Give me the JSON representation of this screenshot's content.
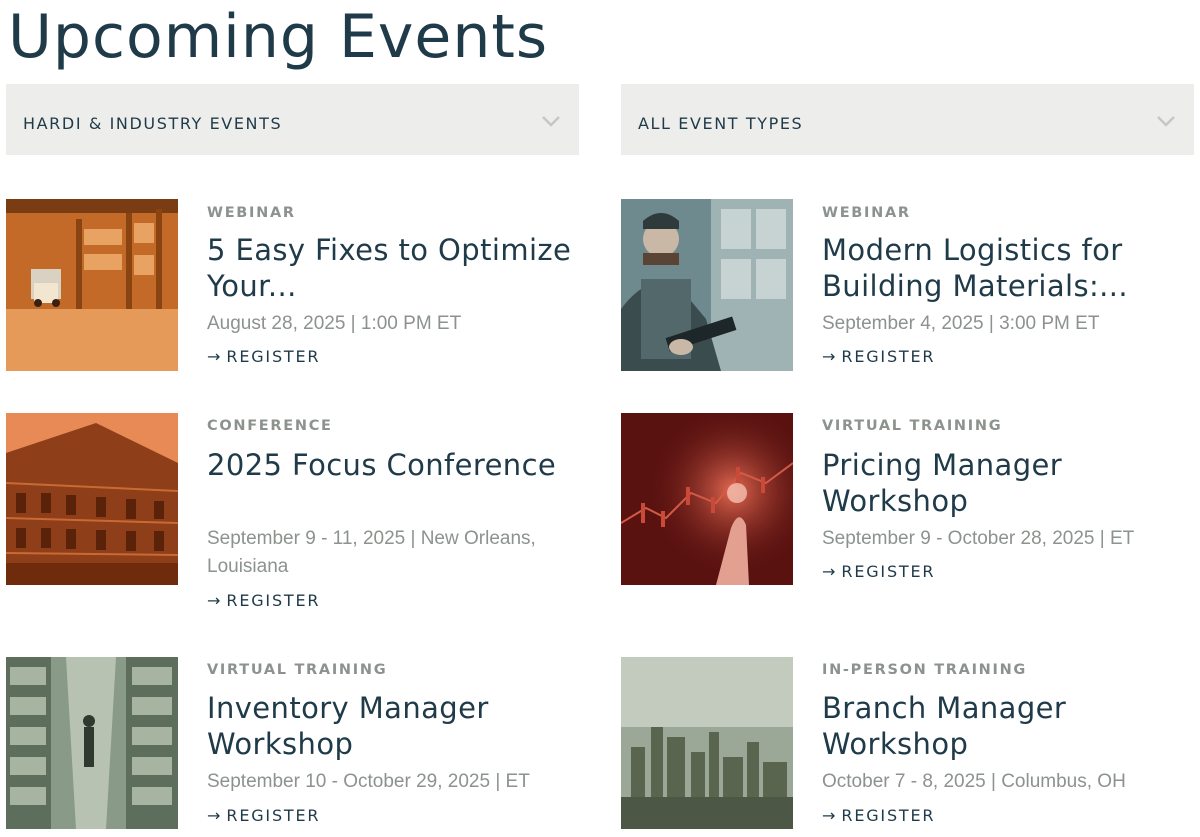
{
  "page": {
    "title": "Upcoming Events"
  },
  "filters": [
    {
      "label": "HARDI & INDUSTRY EVENTS",
      "icon": "chevron-down-icon"
    },
    {
      "label": "ALL EVENT TYPES",
      "icon": "chevron-down-icon"
    }
  ],
  "register_arrow": "→",
  "colors": {
    "heading": "#1f3a48",
    "muted": "#8c928d",
    "filter_bg": "#ededeb"
  },
  "events": [
    {
      "type": "WEBINAR",
      "title": "5 Easy Fixes to Optimize Your...",
      "date": "August 28, 2025 | 1:00 PM ET",
      "register": "REGISTER",
      "image": "warehouse-orange"
    },
    {
      "type": "WEBINAR",
      "title": "Modern Logistics for Building Materials:...",
      "date": "September 4, 2025 | 3:00 PM ET",
      "register": "REGISTER",
      "image": "worker-tablet-teal"
    },
    {
      "type": "CONFERENCE",
      "title": "2025 Focus Conference",
      "date": "September 9 - 11, 2025 | New Orleans, Louisiana",
      "register": "REGISTER",
      "image": "new-orleans-building-orange"
    },
    {
      "type": "VIRTUAL TRAINING",
      "title": "Pricing Manager Workshop",
      "date": "September 9 - October 28, 2025 | ET",
      "register": "REGISTER",
      "image": "finance-touch-red"
    },
    {
      "type": "VIRTUAL TRAINING",
      "title": "Inventory Manager Workshop",
      "date": "September 10 - October 29, 2025 | ET",
      "register": "REGISTER",
      "image": "warehouse-aisle-green"
    },
    {
      "type": "IN-PERSON TRAINING",
      "title": "Branch Manager Workshop",
      "date": "October 7 - 8, 2025 | Columbus, OH",
      "register": "REGISTER",
      "image": "city-skyline-green"
    }
  ]
}
